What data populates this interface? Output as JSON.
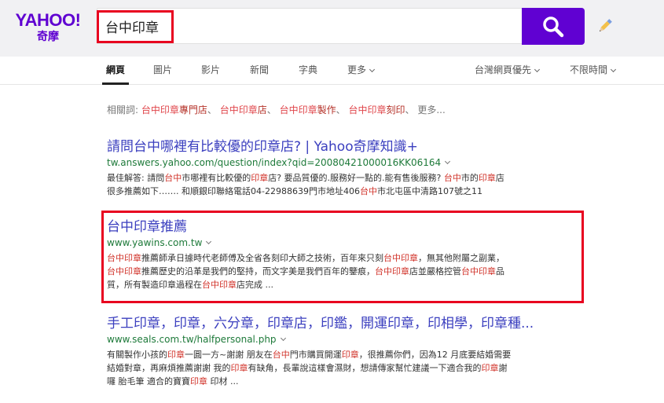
{
  "logo": {
    "main": "YAHOO!",
    "sub": "奇摩"
  },
  "search": {
    "query": "台中印章"
  },
  "tabs": [
    {
      "label": "網頁"
    },
    {
      "label": "圖片"
    },
    {
      "label": "影片"
    },
    {
      "label": "新聞"
    },
    {
      "label": "字典"
    },
    {
      "label": "更多"
    }
  ],
  "filters": {
    "region": "台灣網頁優先",
    "time": "不限時間"
  },
  "related": {
    "label": "相關詞:",
    "items": [
      {
        "pre": "台中印章",
        "post": "專門店"
      },
      {
        "pre": "台中印章",
        "post": "店"
      },
      {
        "pre": "台中印章",
        "post": "製作"
      },
      {
        "pre": "台中印章",
        "post": "刻印"
      }
    ],
    "more": "更多..."
  },
  "results": [
    {
      "title": "請問台中哪裡有比較優的印章店? | Yahoo奇摩知識+",
      "url": "tw.answers.yahoo.com/question/index?qid=20080421000016KK06164",
      "line1": [
        {
          "t": "最佳解答: 請問"
        },
        {
          "t": "台中",
          "h": true
        },
        {
          "t": "市哪裡有比較優的"
        },
        {
          "t": "印章",
          "h": true
        },
        {
          "t": "店? 要品質優的.服務好一點的.能有售後服務? "
        },
        {
          "t": "台中",
          "h": true
        },
        {
          "t": "市的"
        },
        {
          "t": "印章",
          "h": true
        },
        {
          "t": "店"
        }
      ],
      "line2": [
        {
          "t": "很多推薦如下……. 和順銀印聯絡電話04-22988639門市地址406"
        },
        {
          "t": "台中",
          "h": true
        },
        {
          "t": "市北屯區中清路107號之11"
        }
      ],
      "line3": []
    },
    {
      "title": "台中印章推薦",
      "url": "www.yawins.com.tw",
      "line1": [
        {
          "t": "台中印章",
          "h": true
        },
        {
          "t": "推薦師承日據時代老師傅及全省各刻印大師之技術，百年來只刻"
        },
        {
          "t": "台中印章",
          "h": true
        },
        {
          "t": "，無其他附屬之副業，"
        }
      ],
      "line2": [
        {
          "t": "台中印章",
          "h": true
        },
        {
          "t": "推薦歷史的沿革是我們的堅持，而文字美是我們百年的鑒痕，"
        },
        {
          "t": "台中印章",
          "h": true
        },
        {
          "t": "店並嚴格控管"
        },
        {
          "t": "台中印章",
          "h": true
        },
        {
          "t": "品"
        }
      ],
      "line3": [
        {
          "t": "質，所有製造印章過程在"
        },
        {
          "t": "台中印章",
          "h": true
        },
        {
          "t": "店完成 ..."
        }
      ]
    },
    {
      "title": "手工印章，印章，六分章，印章店，印鑑，開運印章，印相學，印章種...",
      "url": "www.seals.com.tw/halfpersonal.php",
      "line1": [
        {
          "t": "有關製作小孩的"
        },
        {
          "t": "印章",
          "h": true
        },
        {
          "t": "一圓一方~謝謝 朋友在"
        },
        {
          "t": "台中",
          "h": true
        },
        {
          "t": "門市購買開運"
        },
        {
          "t": "印章",
          "h": true
        },
        {
          "t": "，很推薦你們，因為12 月底要結婚需要"
        }
      ],
      "line2": [
        {
          "t": "結婚對章，再麻煩推薦謝謝 我的"
        },
        {
          "t": "印章",
          "h": true
        },
        {
          "t": "有缺角，長輩說這樣會濕財，想請傳家幫忙建議一下適合我的"
        },
        {
          "t": "印章",
          "h": true
        },
        {
          "t": "謝"
        }
      ],
      "line3": [
        {
          "t": "囉 胎毛筆 適合的寶寶"
        },
        {
          "t": "印章",
          "h": true
        },
        {
          "t": " 印材 ..."
        }
      ]
    }
  ]
}
